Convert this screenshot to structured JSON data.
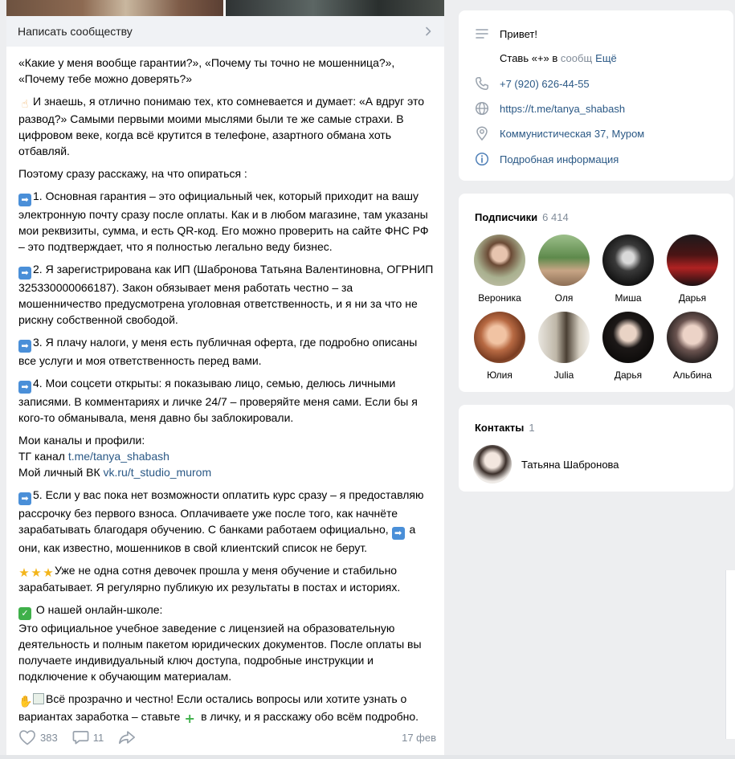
{
  "post": {
    "write_label": "Написать сообществу",
    "paragraphs": {
      "p1": "«Какие у меня вообще гарантии?», «Почему ты точно не мошенница?», «Почему тебе можно доверять?»",
      "p2": "И знаешь, я отлично понимаю тех, кто сомневается и думает: «А вдруг это развод?» Самыми первыми моими мыслями были те же самые страхи. В цифровом веке, когда всё крутится в телефоне, азартного обмана хоть отбавляй.",
      "p3": "Поэтому сразу расскажу, на что опираться :",
      "p4": "1. Основная гарантия – это официальный чек, который приходит на вашу электронную почту сразу после оплаты. Как и в любом магазине, там указаны мои реквизиты, сумма, и есть QR-код. Его можно проверить на сайте ФНС РФ – это подтверждает, что я полностью легально веду бизнес.",
      "p5": "2. Я зарегистрирована как ИП (Шабронова Татьяна Валентиновна, ОГРНИП 325330000066187). Закон обязывает меня работать честно – за мошенничество предусмотрена уголовная ответственность, и я ни за что не рискну собственной свободой.",
      "p6": "3. Я плачу налоги, у меня есть публичная оферта, где подробно описаны все услуги и моя ответственность перед вами.",
      "p7": "4. Мои соцсети открыты: я показываю лицо, семью, делюсь личными записями. В комментариях и личке 24/7 – проверяйте меня сами. Если бы я кого-то обманывала, меня давно бы заблокировали.",
      "p8_title": "Мои каналы и профили:",
      "p8_tg_label": "ТГ канал ",
      "p8_tg_link": "t.me/tanya_shabash",
      "p8_vk_label": "Мой личный ВК ",
      "p8_vk_link": "vk.ru/t_studio_murom",
      "p9a": "5. Если у вас пока нет возможности оплатить курс сразу – я предоставляю рассрочку без первого взноса. Оплачиваете уже после того, как начнёте зарабатывать благодаря обучению. С банками работаем официально, ",
      "p9b": " а они, как известно, мошенников в свой клиентский список не берут.",
      "p10": "Уже не одна сотня девочек прошла у меня обучение и стабильно зарабатывает. Я регулярно публикую их результаты в постах и историях.",
      "p11_title": "О нашей онлайн-школе:",
      "p11_body": "Это официальное учебное заведение с лицензией на образовательную деятельность и полным пакетом юридических документов. После оплаты вы получаете индивидуальный ключ доступа, подробные инструкции и подключение к обучающим материалам.",
      "p12a": "Всё прозрачно и честно! Если остались вопросы или хотите узнать о вариантах заработка – ставьте ",
      "p12b": " в личку, и я расскажу обо всём подробно."
    },
    "likes": "383",
    "comments": "11",
    "date": "17 фев"
  },
  "info": {
    "status": "Привет!",
    "status_more_prefix": "Ставь «+» в",
    "status_more_faded": " сообщ",
    "status_more_link": "Ещё",
    "phone": "+7 (920) 626-44-55",
    "site": "https://t.me/tanya_shabash",
    "address": "Коммунистическая 37, Муром",
    "details": "Подробная информация"
  },
  "subscribers": {
    "title": "Подписчики",
    "count": "6 414",
    "people": [
      {
        "name": "Вероника"
      },
      {
        "name": "Оля"
      },
      {
        "name": "Миша"
      },
      {
        "name": "Дарья"
      },
      {
        "name": "Юлия"
      },
      {
        "name": "Julia"
      },
      {
        "name": "Дарья"
      },
      {
        "name": "Альбина"
      }
    ]
  },
  "contacts": {
    "title": "Контакты",
    "count": "1",
    "person": "Татьяна Шабронова"
  },
  "colors": {
    "link": "#2a5885",
    "muted": "#818c99",
    "background": "#edeef0"
  }
}
